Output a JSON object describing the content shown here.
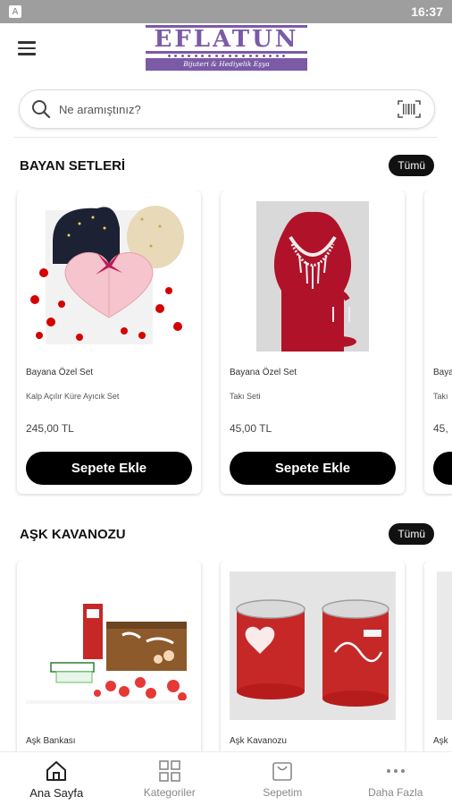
{
  "status_bar": {
    "time": "16:37",
    "app_icon": "A"
  },
  "logo": {
    "title": "EFLATUN",
    "subtitle": "Bijuteri & Hediyelik Eşya"
  },
  "search": {
    "placeholder": "Ne aramıştınız?"
  },
  "colors": {
    "brand": "#7b5aa6",
    "button": "#000000",
    "status_bar": "#9e9e9e"
  },
  "sections": [
    {
      "title": "BAYAN SETLERİ",
      "all_label": "Tümü",
      "products": [
        {
          "category": "Bayana Özel Set",
          "name": "Kalp Açılır Küre Ayıcık Set",
          "price": "245,00 TL",
          "button": "Sepete Ekle"
        },
        {
          "category": "Bayana Özel Set",
          "name": "Takı Seti",
          "price": "45,00 TL",
          "button": "Sepete Ekle"
        },
        {
          "category": "Baya",
          "name": "Takı",
          "price": "45,",
          "button": ""
        }
      ]
    },
    {
      "title": "AŞK KAVANOZU",
      "all_label": "Tümü",
      "products": [
        {
          "category": "Aşk Bankası",
          "name": "",
          "price": "",
          "button": ""
        },
        {
          "category": "Aşk Kavanozu",
          "name": "",
          "price": "",
          "button": ""
        },
        {
          "category": "Aşk",
          "name": "",
          "price": "",
          "button": ""
        }
      ]
    }
  ],
  "bottom_nav": [
    {
      "label": "Ana Sayfa",
      "icon": "home-icon",
      "active": true
    },
    {
      "label": "Kategoriler",
      "icon": "grid-icon",
      "active": false
    },
    {
      "label": "Sepetim",
      "icon": "bag-icon",
      "active": false
    },
    {
      "label": "Daha Fazla",
      "icon": "more-icon",
      "active": false
    }
  ]
}
